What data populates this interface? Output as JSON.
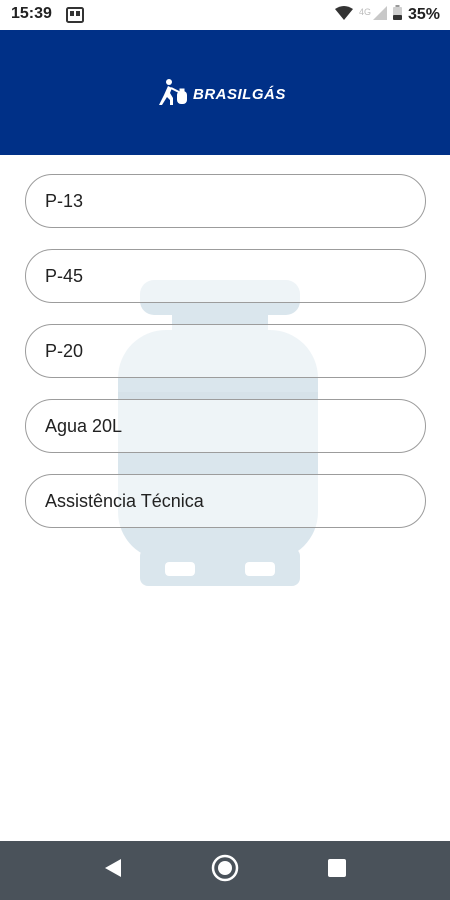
{
  "status_bar": {
    "time": "15:39",
    "network": "4G",
    "battery": "35%"
  },
  "header": {
    "brand_name": "BRASILGÁS",
    "background_color": "#003087"
  },
  "menu": {
    "items": [
      {
        "label": "P-13"
      },
      {
        "label": "P-45"
      },
      {
        "label": "P-20"
      },
      {
        "label": "Agua 20L"
      },
      {
        "label": "Assistência Técnica"
      }
    ]
  },
  "nav_bar": {
    "buttons": [
      "back-icon",
      "home-icon",
      "recents-icon"
    ]
  }
}
